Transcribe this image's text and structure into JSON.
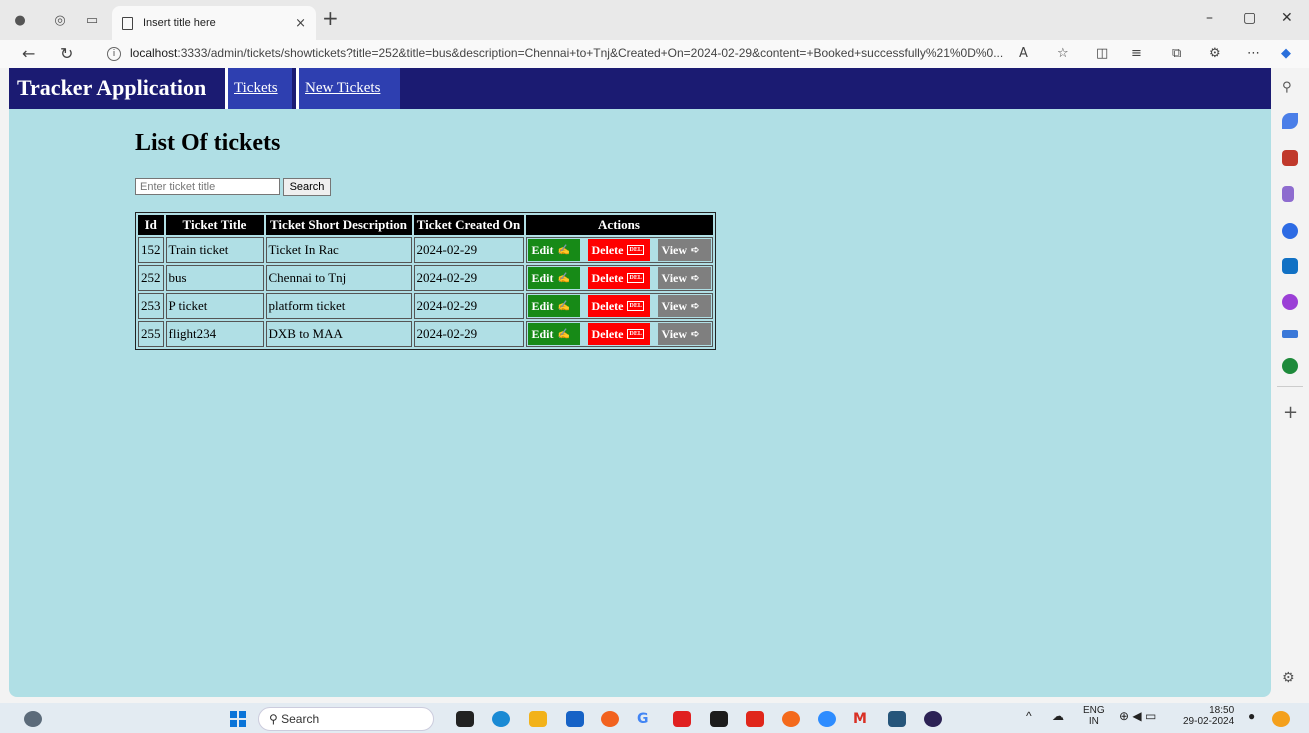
{
  "browser": {
    "tab_title": "Insert title here",
    "tab_close": "×",
    "new_tab": "+",
    "url_host": "localhost",
    "url_rest": ":3333/admin/tickets/showtickets?title=252&title=bus&description=Chennai+to+Tnj&Created+On=2024-02-29&content=+Booked+successfully%21%0D%0..."
  },
  "navbar": {
    "brand": "Tracker Application",
    "links": [
      "Tickets",
      "New Tickets"
    ]
  },
  "page": {
    "heading": "List Of tickets",
    "search_placeholder": "Enter ticket title",
    "search_button": "Search"
  },
  "table": {
    "headers": [
      "Id",
      "Ticket Title",
      "Ticket Short Description",
      "Ticket Created On",
      "Actions"
    ],
    "rows": [
      {
        "id": "152",
        "title": "Train ticket",
        "desc": "Ticket In Rac",
        "date": "2024-02-29"
      },
      {
        "id": "252",
        "title": "bus",
        "desc": "Chennai to Tnj",
        "date": "2024-02-29"
      },
      {
        "id": "253",
        "title": "P ticket",
        "desc": "platform ticket",
        "date": "2024-02-29"
      },
      {
        "id": "255",
        "title": "flight234",
        "desc": "DXB to MAA",
        "date": "2024-02-29"
      }
    ],
    "actions": {
      "edit": "Edit",
      "delete": "Delete",
      "delete_badge": "DEL",
      "view": "View"
    }
  },
  "taskbar": {
    "search": "Search",
    "lang_top": "ENG",
    "lang_bottom": "IN",
    "time": "18:50",
    "date": "29-02-2024"
  },
  "colors": {
    "page_bg": "#b0dfe5",
    "navbar_bg": "#1b1b72",
    "navlink_bg": "#2e3fb0",
    "edit": "#178a17",
    "delete": "#ff0000",
    "view": "#7f7f7f"
  },
  "icons": [
    "profile-icon",
    "workspaces-icon",
    "tab-actions-icon",
    "back-icon",
    "refresh-icon",
    "info-icon",
    "read-aloud-icon",
    "favorite-icon",
    "split-screen-icon",
    "favorites-icon",
    "collections-icon",
    "extensions-icon",
    "more-icon",
    "copilot-icon",
    "gear-icon",
    "windows-icon"
  ]
}
